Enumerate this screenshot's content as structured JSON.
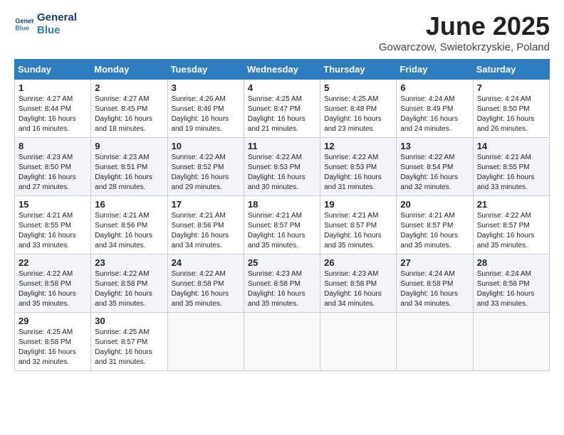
{
  "logo": {
    "line1": "General",
    "line2": "Blue"
  },
  "title": "June 2025",
  "location": "Gowarczow, Swietokrzyskie, Poland",
  "days_header": [
    "Sunday",
    "Monday",
    "Tuesday",
    "Wednesday",
    "Thursday",
    "Friday",
    "Saturday"
  ],
  "weeks": [
    [
      {
        "day": "1",
        "info": "Sunrise: 4:27 AM\nSunset: 8:44 PM\nDaylight: 16 hours\nand 16 minutes."
      },
      {
        "day": "2",
        "info": "Sunrise: 4:27 AM\nSunset: 8:45 PM\nDaylight: 16 hours\nand 18 minutes."
      },
      {
        "day": "3",
        "info": "Sunrise: 4:26 AM\nSunset: 8:46 PM\nDaylight: 16 hours\nand 19 minutes."
      },
      {
        "day": "4",
        "info": "Sunrise: 4:25 AM\nSunset: 8:47 PM\nDaylight: 16 hours\nand 21 minutes."
      },
      {
        "day": "5",
        "info": "Sunrise: 4:25 AM\nSunset: 8:48 PM\nDaylight: 16 hours\nand 23 minutes."
      },
      {
        "day": "6",
        "info": "Sunrise: 4:24 AM\nSunset: 8:49 PM\nDaylight: 16 hours\nand 24 minutes."
      },
      {
        "day": "7",
        "info": "Sunrise: 4:24 AM\nSunset: 8:50 PM\nDaylight: 16 hours\nand 26 minutes."
      }
    ],
    [
      {
        "day": "8",
        "info": "Sunrise: 4:23 AM\nSunset: 8:50 PM\nDaylight: 16 hours\nand 27 minutes."
      },
      {
        "day": "9",
        "info": "Sunrise: 4:23 AM\nSunset: 8:51 PM\nDaylight: 16 hours\nand 28 minutes."
      },
      {
        "day": "10",
        "info": "Sunrise: 4:22 AM\nSunset: 8:52 PM\nDaylight: 16 hours\nand 29 minutes."
      },
      {
        "day": "11",
        "info": "Sunrise: 4:22 AM\nSunset: 8:53 PM\nDaylight: 16 hours\nand 30 minutes."
      },
      {
        "day": "12",
        "info": "Sunrise: 4:22 AM\nSunset: 8:53 PM\nDaylight: 16 hours\nand 31 minutes."
      },
      {
        "day": "13",
        "info": "Sunrise: 4:22 AM\nSunset: 8:54 PM\nDaylight: 16 hours\nand 32 minutes."
      },
      {
        "day": "14",
        "info": "Sunrise: 4:21 AM\nSunset: 8:55 PM\nDaylight: 16 hours\nand 33 minutes."
      }
    ],
    [
      {
        "day": "15",
        "info": "Sunrise: 4:21 AM\nSunset: 8:55 PM\nDaylight: 16 hours\nand 33 minutes."
      },
      {
        "day": "16",
        "info": "Sunrise: 4:21 AM\nSunset: 8:56 PM\nDaylight: 16 hours\nand 34 minutes."
      },
      {
        "day": "17",
        "info": "Sunrise: 4:21 AM\nSunset: 8:56 PM\nDaylight: 16 hours\nand 34 minutes."
      },
      {
        "day": "18",
        "info": "Sunrise: 4:21 AM\nSunset: 8:57 PM\nDaylight: 16 hours\nand 35 minutes."
      },
      {
        "day": "19",
        "info": "Sunrise: 4:21 AM\nSunset: 8:57 PM\nDaylight: 16 hours\nand 35 minutes."
      },
      {
        "day": "20",
        "info": "Sunrise: 4:21 AM\nSunset: 8:57 PM\nDaylight: 16 hours\nand 35 minutes."
      },
      {
        "day": "21",
        "info": "Sunrise: 4:22 AM\nSunset: 8:57 PM\nDaylight: 16 hours\nand 35 minutes."
      }
    ],
    [
      {
        "day": "22",
        "info": "Sunrise: 4:22 AM\nSunset: 8:58 PM\nDaylight: 16 hours\nand 35 minutes."
      },
      {
        "day": "23",
        "info": "Sunrise: 4:22 AM\nSunset: 8:58 PM\nDaylight: 16 hours\nand 35 minutes."
      },
      {
        "day": "24",
        "info": "Sunrise: 4:22 AM\nSunset: 8:58 PM\nDaylight: 16 hours\nand 35 minutes."
      },
      {
        "day": "25",
        "info": "Sunrise: 4:23 AM\nSunset: 8:58 PM\nDaylight: 16 hours\nand 35 minutes."
      },
      {
        "day": "26",
        "info": "Sunrise: 4:23 AM\nSunset: 8:58 PM\nDaylight: 16 hours\nand 34 minutes."
      },
      {
        "day": "27",
        "info": "Sunrise: 4:24 AM\nSunset: 8:58 PM\nDaylight: 16 hours\nand 34 minutes."
      },
      {
        "day": "28",
        "info": "Sunrise: 4:24 AM\nSunset: 8:58 PM\nDaylight: 16 hours\nand 33 minutes."
      }
    ],
    [
      {
        "day": "29",
        "info": "Sunrise: 4:25 AM\nSunset: 8:58 PM\nDaylight: 16 hours\nand 32 minutes."
      },
      {
        "day": "30",
        "info": "Sunrise: 4:25 AM\nSunset: 8:57 PM\nDaylight: 16 hours\nand 31 minutes."
      },
      null,
      null,
      null,
      null,
      null
    ]
  ]
}
